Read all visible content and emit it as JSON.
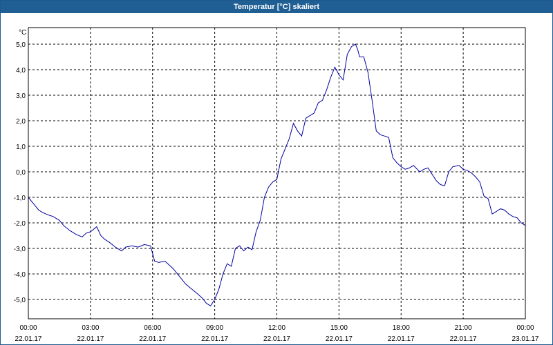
{
  "window": {
    "title": "Temperatur [°C] skaliert"
  },
  "chart_data": {
    "type": "line",
    "title": "Temperatur [°C] skaliert",
    "y_unit_label": "°C",
    "ylim": [
      -5.5,
      5.5
    ],
    "y_ticks": [
      {
        "value": 5.0,
        "label": "5,0"
      },
      {
        "value": 4.0,
        "label": "4,0"
      },
      {
        "value": 3.0,
        "label": "3,0"
      },
      {
        "value": 2.0,
        "label": "2,0"
      },
      {
        "value": 1.0,
        "label": "1,0"
      },
      {
        "value": 0.0,
        "label": "0,0"
      },
      {
        "value": -1.0,
        "label": "-1,0"
      },
      {
        "value": -2.0,
        "label": "-2,0"
      },
      {
        "value": -3.0,
        "label": "-3,0"
      },
      {
        "value": -4.0,
        "label": "-4,0"
      },
      {
        "value": -5.0,
        "label": "-5,0"
      }
    ],
    "x_range_hours": [
      0,
      24
    ],
    "x_ticks": [
      {
        "hour": 0,
        "time": "00:00",
        "date": "22.01.17"
      },
      {
        "hour": 3,
        "time": "03:00",
        "date": "22.01.17"
      },
      {
        "hour": 6,
        "time": "06:00",
        "date": "22.01.17"
      },
      {
        "hour": 9,
        "time": "09:00",
        "date": "22.01.17"
      },
      {
        "hour": 12,
        "time": "12:00",
        "date": "22.01.17"
      },
      {
        "hour": 15,
        "time": "15:00",
        "date": "22.01.17"
      },
      {
        "hour": 18,
        "time": "18:00",
        "date": "22.01.17"
      },
      {
        "hour": 21,
        "time": "21:00",
        "date": "22.01.17"
      },
      {
        "hour": 24,
        "time": "00:00",
        "date": "23.01.17"
      }
    ],
    "grid": true,
    "series": [
      {
        "color": "#0000a0",
        "x": [
          0,
          0.3,
          0.5,
          0.7,
          1.0,
          1.2,
          1.5,
          1.7,
          2.0,
          2.3,
          2.6,
          2.8,
          3.0,
          3.3,
          3.5,
          3.7,
          3.9,
          4.2,
          4.5,
          4.7,
          5.0,
          5.3,
          5.6,
          5.9,
          6.1,
          6.3,
          6.6,
          7.0,
          7.3,
          7.6,
          7.9,
          8.2,
          8.4,
          8.6,
          8.8,
          9.0,
          9.2,
          9.4,
          9.6,
          9.8,
          10.0,
          10.2,
          10.4,
          10.6,
          10.8,
          11.0,
          11.2,
          11.4,
          11.6,
          11.8,
          12.0,
          12.2,
          12.4,
          12.6,
          12.8,
          13.0,
          13.2,
          13.4,
          13.6,
          13.8,
          14.0,
          14.2,
          14.4,
          14.6,
          14.8,
          15.0,
          15.2,
          15.4,
          15.6,
          15.8,
          15.9,
          16.0,
          16.2,
          16.4,
          16.6,
          16.8,
          17.0,
          17.2,
          17.4,
          17.6,
          17.8,
          18.0,
          18.2,
          18.4,
          18.6,
          18.9,
          19.1,
          19.3,
          19.5,
          19.7,
          19.9,
          20.1,
          20.3,
          20.5,
          20.8,
          21.0,
          21.2,
          21.4,
          21.6,
          21.8,
          22.0,
          22.2,
          22.4,
          22.6,
          22.8,
          23.0,
          23.2,
          23.4,
          23.6,
          23.8,
          24.0
        ],
        "y": [
          -1.0,
          -1.3,
          -1.5,
          -1.6,
          -1.7,
          -1.75,
          -1.9,
          -2.1,
          -2.3,
          -2.45,
          -2.55,
          -2.4,
          -2.35,
          -2.15,
          -2.5,
          -2.65,
          -2.75,
          -2.95,
          -3.1,
          -2.95,
          -2.9,
          -2.95,
          -2.85,
          -2.9,
          -3.5,
          -3.55,
          -3.5,
          -3.8,
          -4.1,
          -4.4,
          -4.6,
          -4.8,
          -4.95,
          -5.15,
          -5.25,
          -5.0,
          -4.6,
          -4.0,
          -3.6,
          -3.7,
          -3.0,
          -2.9,
          -3.1,
          -2.95,
          -3.05,
          -2.35,
          -1.9,
          -1.0,
          -0.6,
          -0.4,
          -0.3,
          0.5,
          0.9,
          1.3,
          1.9,
          1.6,
          1.4,
          2.1,
          2.2,
          2.3,
          2.7,
          2.8,
          3.2,
          3.7,
          4.1,
          3.8,
          3.6,
          4.6,
          4.9,
          5.0,
          4.8,
          4.5,
          4.5,
          3.9,
          2.8,
          1.6,
          1.45,
          1.4,
          1.35,
          0.55,
          0.35,
          0.2,
          0.1,
          0.15,
          0.25,
          0.0,
          0.1,
          0.15,
          -0.1,
          -0.35,
          -0.5,
          -0.55,
          0.0,
          0.2,
          0.25,
          0.1,
          0.05,
          -0.05,
          -0.2,
          -0.4,
          -0.95,
          -1.05,
          -1.65,
          -1.55,
          -1.45,
          -1.5,
          -1.65,
          -1.75,
          -1.8,
          -2.0,
          -2.1
        ]
      }
    ]
  }
}
